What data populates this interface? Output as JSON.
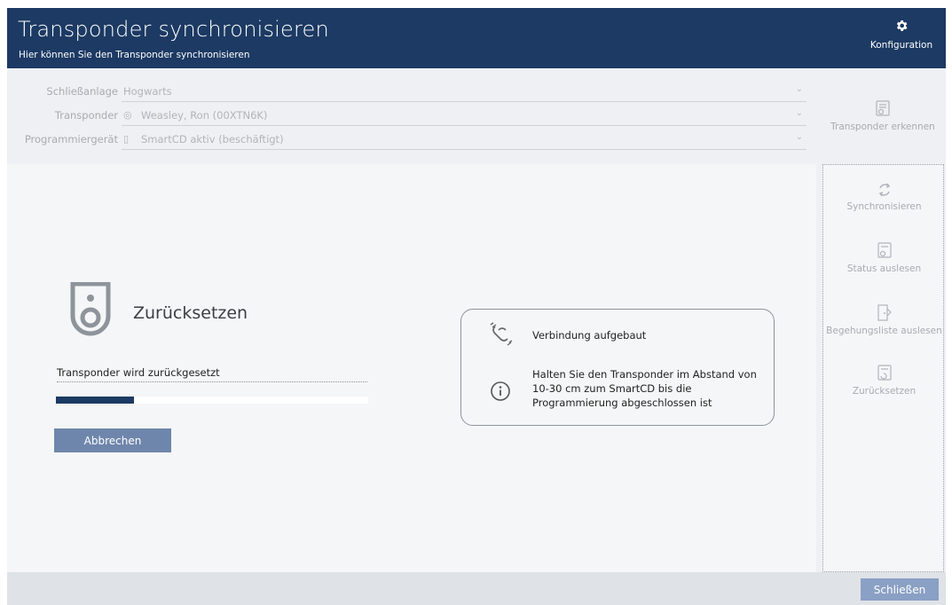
{
  "header": {
    "title": "Transponder synchronisieren",
    "subtitle": "Hier können Sie den Transponder synchronisieren",
    "config_label": "Konfiguration",
    "config_icon": "gear-icon"
  },
  "form": {
    "rows": [
      {
        "label": "Schließanlage",
        "value": "Hogwarts",
        "icon": ""
      },
      {
        "label": "Transponder",
        "value": "Weasley, Ron (00XTN6K)",
        "icon": "transponder-icon"
      },
      {
        "label": "Programmiergerät",
        "value": "SmartCD aktiv (beschäftigt)",
        "icon": "device-icon"
      }
    ],
    "recognize_label": "Transponder erkennen"
  },
  "sidebar": {
    "items": [
      {
        "label": "Synchronisieren",
        "icon": "sync-icon"
      },
      {
        "label": "Status auslesen",
        "icon": "read-status-icon"
      },
      {
        "label": "Begehungsliste auslesen",
        "icon": "access-list-icon"
      },
      {
        "label": "Zurücksetzen",
        "icon": "reset-icon"
      }
    ]
  },
  "main": {
    "title": "Zurücksetzen",
    "status_text": "Transponder wird zurückgesetzt",
    "progress": 0.25,
    "cancel_label": "Abbrechen"
  },
  "info": {
    "connection_text": "Verbindung aufgebaut",
    "hint_lines": [
      "Halten Sie den Transponder im Abstand von",
      "10-30 cm zum SmartCD bis die",
      "Programmierung abgeschlossen ist"
    ]
  },
  "footer": {
    "close_label": "Schließen"
  },
  "colors": {
    "header_bg": "#1c3a63",
    "button": "#6f86ac",
    "progress": "#1c3a63"
  }
}
